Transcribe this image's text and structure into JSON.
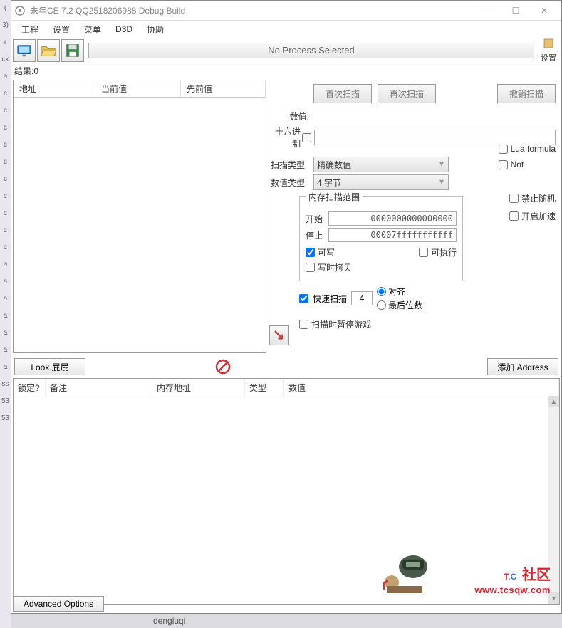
{
  "titlebar": {
    "text": "未年CE 7.2 QQ2518206988 Debug Build"
  },
  "menu": {
    "items": [
      "工程",
      "设置",
      "菜单",
      "D3D",
      "协助"
    ]
  },
  "process": {
    "label": "No Process Selected"
  },
  "settings_label": "设置",
  "results": {
    "label": "结果:",
    "count": "0"
  },
  "scan_table": {
    "headers": [
      "地址",
      "当前值",
      "先前值"
    ]
  },
  "scan_buttons": {
    "first": "首次扫描",
    "next": "再次扫描",
    "undo": "撤销扫描"
  },
  "value": {
    "label": "数值:",
    "hex_label": "十六进制",
    "input": ""
  },
  "scan_type": {
    "label": "扫描类型",
    "value": "精确数值"
  },
  "value_type": {
    "label": "数值类型",
    "value": "4 字节"
  },
  "side_checks": {
    "lua": "Lua formula",
    "not": "Not",
    "no_random": "禁止随机",
    "accel": "开启加速"
  },
  "mem_range": {
    "legend": "内存扫描范围",
    "start_label": "开始",
    "start": "0000000000000000",
    "stop_label": "停止",
    "stop": "00007fffffffffff",
    "writable": "可写",
    "executable": "可执行",
    "cow": "写时拷贝"
  },
  "fast_scan": {
    "label": "快速扫描",
    "value": "4",
    "align": "对齐",
    "lastdigit": "最后位数"
  },
  "pause": {
    "label": "扫描时暂停游戏"
  },
  "look_btn": "Look 屁屁",
  "add_addr_btn": "添加 Address",
  "cheat_table": {
    "headers": [
      "锁定?",
      "备注",
      "内存地址",
      "类型",
      "数值"
    ]
  },
  "adv_options": "Advanced Options",
  "taskbar": {
    "item1": "dengluqi"
  },
  "watermark": {
    "brand_t": "T",
    "brand_c": "C",
    "brand_s": "社区",
    "url": "www.tcsqw.com"
  }
}
